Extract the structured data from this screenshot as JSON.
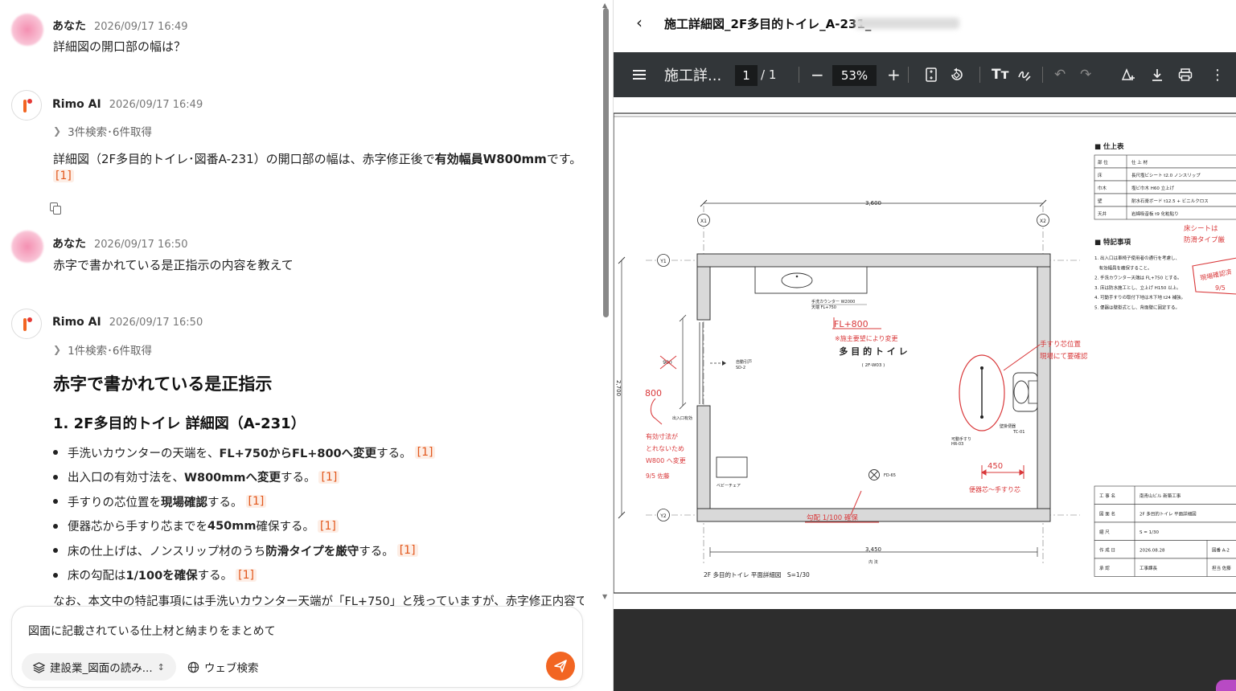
{
  "chat": {
    "messages": [
      {
        "author": "あなた",
        "time": "2026/09/17 16:49",
        "text": "詳細図の開口部の幅は？"
      },
      {
        "author": "Rimo AI",
        "time": "2026/09/17 16:49",
        "search": "3件検索･6件取得",
        "text_pre": "詳細図（2F多目的トイレ･図番A-231）の開口部の幅は、赤字修正後で",
        "text_bold": "有効幅員W800mm",
        "text_post": "です。",
        "cite": "[1]"
      },
      {
        "author": "あなた",
        "time": "2026/09/17 16:50",
        "text": "赤字で書かれている是正指示の内容を教えて"
      },
      {
        "author": "Rimo AI",
        "time": "2026/09/17 16:50",
        "search": "1件検索･6件取得",
        "heading": "赤字で書かれている是正指示",
        "subheading": "1. 2F多目的トイレ 詳細図（A-231）"
      }
    ],
    "bullets": [
      {
        "pre": "手洗いカウンターの天端を、",
        "bold": "FL+750からFL+800へ変更",
        "post": "する。",
        "cite": "[1]"
      },
      {
        "pre": "出入口の有効寸法を、",
        "bold": "W800mmへ変更",
        "post": "する。",
        "cite": "[1]"
      },
      {
        "pre": "手すりの芯位置を",
        "bold": "現場確認",
        "post": "する。",
        "cite": "[1]"
      },
      {
        "pre": "便器芯から手すり芯までを",
        "bold": "450mm",
        "post": "確保する。",
        "cite": "[1]"
      },
      {
        "pre": "床の仕上げは、ノンスリップ材のうち",
        "bold": "防滑タイプを厳守",
        "post": "する。",
        "cite": "[1]"
      },
      {
        "pre": "床の勾配は",
        "bold": "1/100を確保",
        "post": "する。",
        "cite": "[1]"
      }
    ],
    "trailing_text": "なお、本文中の特記事項には手洗いカウンター天端が「FL+750」と残っていますが、赤字修正内容では"
  },
  "composer": {
    "value": "図面に記載されている仕上材と納まりをまとめて",
    "kb_label": "建設業_図面の読み...",
    "web_label": "ウェブ検索"
  },
  "pdf": {
    "file_name": "施工詳細図_2F多目的トイレ_A-231_",
    "toolbar_title": "施工詳...",
    "page_current": "1",
    "page_total": "/ 1",
    "zoom": "53%"
  },
  "drawing": {
    "finish_title": "■ 仕上表",
    "finish_rows": [
      [
        "部 位",
        "仕 上 材"
      ],
      [
        "床",
        "長尺塩ビシート t2.0 ノンスリップ"
      ],
      [
        "巾木",
        "塩ビ巾木 H60 立上げ"
      ],
      [
        "壁",
        "耐水石膏ボード t12.5 + ビニルクロス"
      ],
      [
        "天井",
        "岩綿吸音板 t9 化粧貼り"
      ]
    ],
    "notes_title": "■ 特記事項",
    "notes": [
      "1. 出入口は車椅子使用者の通行を考慮し、",
      "　有効幅員を確保すること。",
      "2. 手洗カウンター天端は FL+750 とする。",
      "3. 床は防水施工とし、立上げ H150 以上。",
      "4. 可動手すりの取付下地は木下地 t24 補強。",
      "5. 便器は壁掛式とし、背面壁に固定する。"
    ],
    "title_block": [
      [
        "工 事 名",
        "南青山ビル 新築工事"
      ],
      [
        "図 面 名",
        "2F 多目的トイレ 平面詳細図"
      ],
      [
        "縮 尺",
        "S = 1/30"
      ],
      [
        "作 成 日",
        "2026.08.28",
        "図番 A-2"
      ],
      [
        "承 認",
        "工事課長",
        "担当 佐藤"
      ]
    ],
    "dim_top": "3,600",
    "dim_bottom": "3,450",
    "dim_bottom_sub": "内 法",
    "dim_left": "2,700",
    "grid_x1": "X1",
    "grid_x2": "X2",
    "grid_y1": "Y1",
    "grid_y2": "Y2",
    "room_name": "多 目 的 ト イ レ",
    "room_code": "( 2F-W03 )",
    "counter_label_1": "手洗カウンター W2000",
    "counter_label_2": "天端 FL+750",
    "door_label_1": "自動引戸",
    "door_label_2": "SD-2",
    "entrance_label": "出入口有効",
    "dim_900": "900",
    "baby_chair": "ベビーチェア",
    "drain": "FD-65",
    "handrail_1": "可動手すり",
    "handrail_2": "HR-03",
    "toilet_1": "壁掛便器",
    "toilet_2": "TC-01",
    "drawing_title": "2F 多目的トイレ 平面詳細図　S=1/30",
    "red_fl": "FL+800",
    "red_fl_note": "※施主要望により変更",
    "red_800": "800",
    "red_width_1": "有効寸法が",
    "red_width_2": "とれないため",
    "red_width_3": "W800 へ変更",
    "red_sign": "9/5 佐藤",
    "red_rail_1": "手すり芯位置",
    "red_rail_2": "現場にて要確認",
    "red_450": "450",
    "red_450_note": "便器芯～手すり芯",
    "red_slope": "勾配 1/100 確保",
    "red_floor_1": "床シートは",
    "red_floor_2": "防滑タイプ厳",
    "red_confirm_1": "現場確認済",
    "red_confirm_2": "9/5"
  }
}
